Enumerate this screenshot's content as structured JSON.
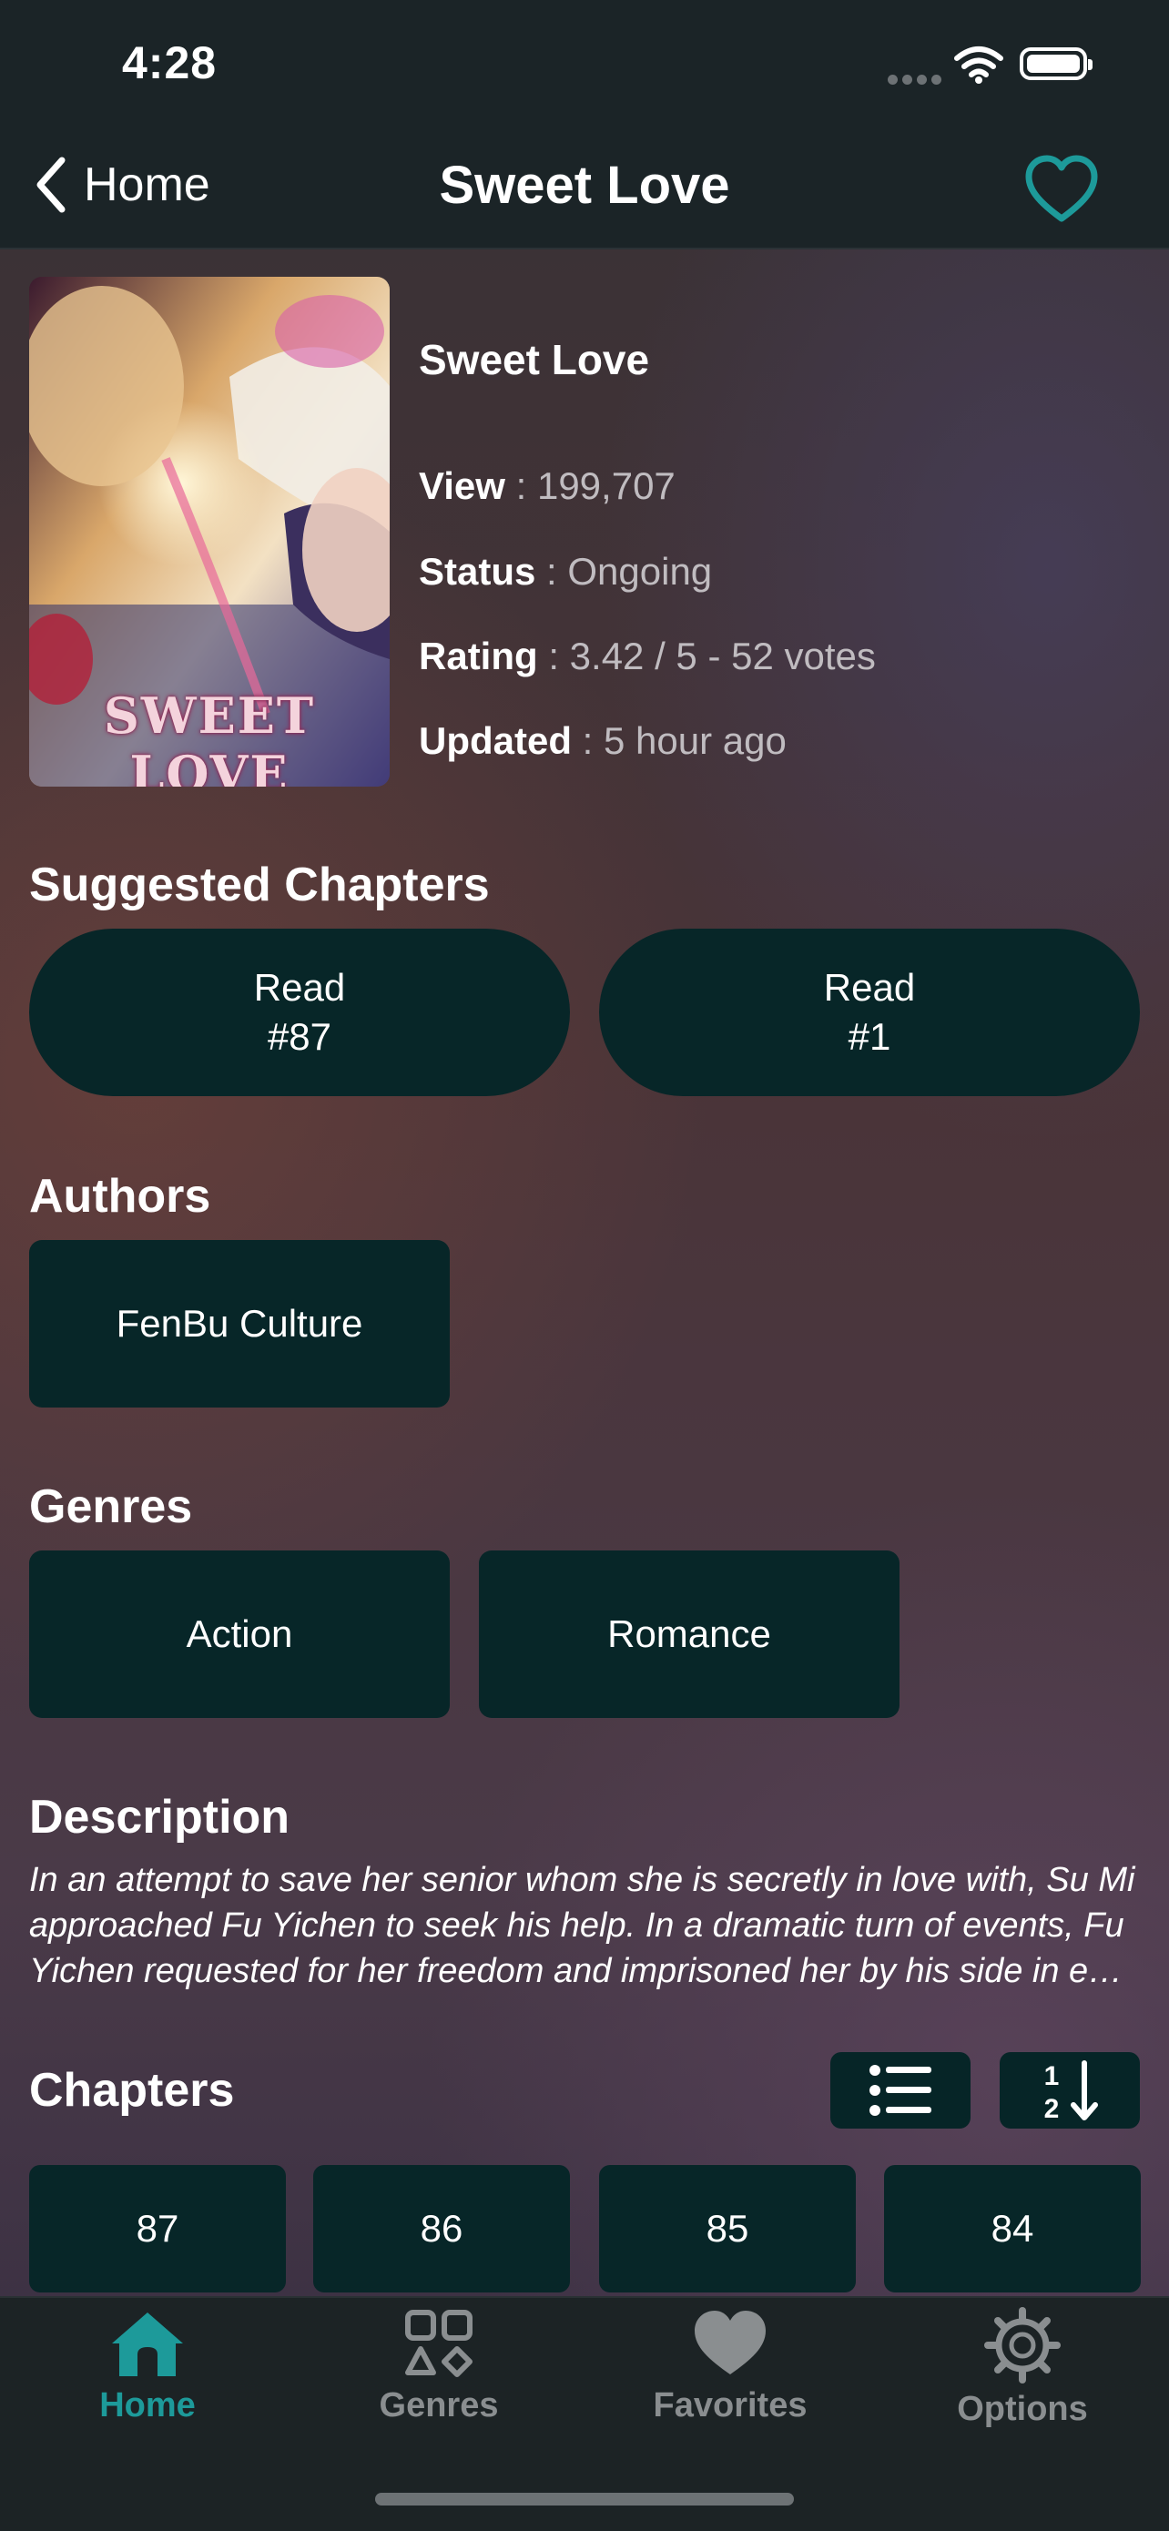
{
  "status_bar": {
    "time": "4:28"
  },
  "nav": {
    "back_label": "Home",
    "title": "Sweet Love"
  },
  "manga": {
    "title": "Sweet Love",
    "cover_art_text": "SWEET LOVE",
    "view_label": "View",
    "view_value": " : 199,707",
    "status_label": "Status",
    "status_value": " : Ongoing",
    "rating_label": "Rating",
    "rating_value": " : 3.42 / 5 - 52 votes",
    "updated_label": "Updated",
    "updated_value": " : 5 hour ago"
  },
  "suggested": {
    "heading": "Suggested Chapters",
    "items": [
      {
        "line1": "Read",
        "line2": "#87"
      },
      {
        "line1": "Read",
        "line2": "#1"
      }
    ]
  },
  "authors": {
    "heading": "Authors",
    "items": [
      "FenBu Culture"
    ]
  },
  "genres": {
    "heading": "Genres",
    "items": [
      "Action",
      "Romance"
    ]
  },
  "description": {
    "heading": "Description",
    "lines": [
      "In an attempt to save her senior whom she is secretly in love with, Su Mi",
      "approached Fu Yichen to seek his help. In a dramatic turn of events, Fu",
      "Yichen requested for her freedom and imprisoned her by his side in exc…"
    ]
  },
  "chapters": {
    "heading": "Chapters",
    "items": [
      "87",
      "86",
      "85",
      "84"
    ]
  },
  "tabs": [
    {
      "label": "Home",
      "icon": "house-icon",
      "active": true
    },
    {
      "label": "Genres",
      "icon": "grid-icon",
      "active": false
    },
    {
      "label": "Favorites",
      "icon": "heart-icon",
      "active": false
    },
    {
      "label": "Options",
      "icon": "gear-icon",
      "active": false
    }
  ],
  "colors": {
    "accent": "#1d9a9a",
    "button_bg": "#072628",
    "tab_inactive": "#8a8e90"
  }
}
